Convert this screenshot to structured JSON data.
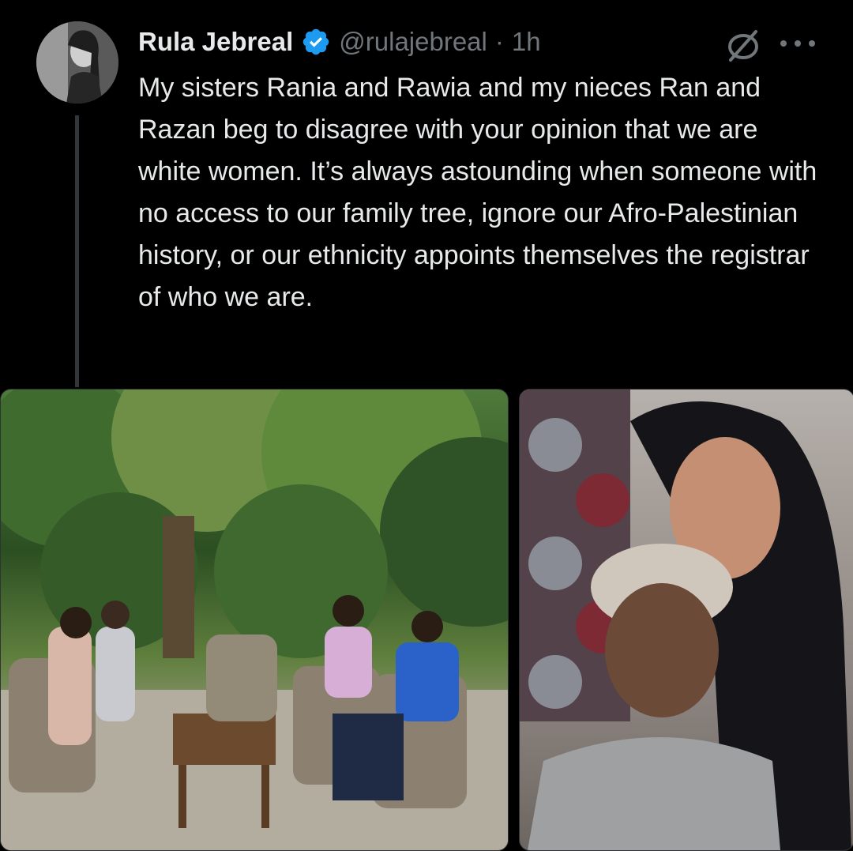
{
  "tweet": {
    "author_name": "Rula Jebreal",
    "handle": "@rulajebreal",
    "separator": "·",
    "time": "1h",
    "text": "My sisters Rania and Rawia and my nieces Ran and Razan beg to disagree with your opinion that we are white women. It’s always astounding when someone with no access to our family tree, ignore our Afro-Palestinian history, or our ethnicity appoints themselves the registrar of who we are."
  },
  "icons": {
    "verified": "verified-badge-icon",
    "grok": "grok-icon",
    "more": "more-icon"
  },
  "colors": {
    "background": "#000000",
    "text": "#e7e9ea",
    "secondary_text": "#71767b",
    "verified_blue": "#1d9bf0",
    "thread_line": "#333639"
  }
}
